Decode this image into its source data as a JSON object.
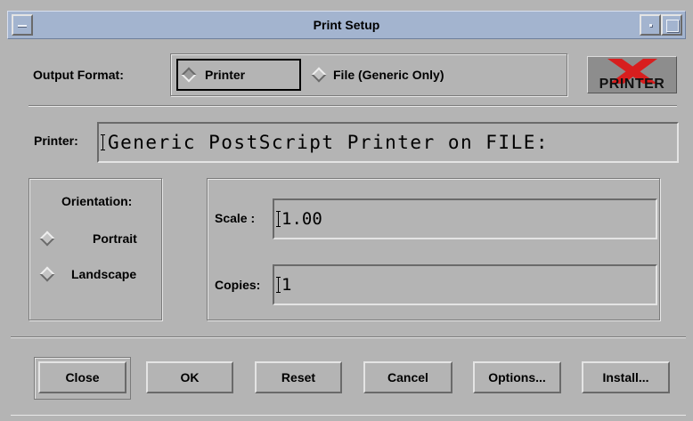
{
  "window": {
    "title": "Print Setup"
  },
  "output": {
    "label": "Output Format:",
    "options": [
      {
        "label": "Printer",
        "selected": true
      },
      {
        "label": "File (Generic Only)",
        "selected": false
      }
    ]
  },
  "logo": {
    "text": "PRINTER",
    "icon": "x-printer-logo",
    "accent": "#d81e1e"
  },
  "printer": {
    "label": "Printer:",
    "value": "Generic PostScript Printer on FILE:"
  },
  "orientation": {
    "label": "Orientation:",
    "options": [
      {
        "label": "Portrait",
        "selected": false
      },
      {
        "label": "Landscape",
        "selected": false
      }
    ]
  },
  "scale": {
    "label": "Scale :",
    "value": "1.00"
  },
  "copies": {
    "label": "Copies:",
    "value": "1"
  },
  "buttons": {
    "close": "Close",
    "ok": "OK",
    "reset": "Reset",
    "cancel": "Cancel",
    "options": "Options...",
    "install": "Install..."
  }
}
